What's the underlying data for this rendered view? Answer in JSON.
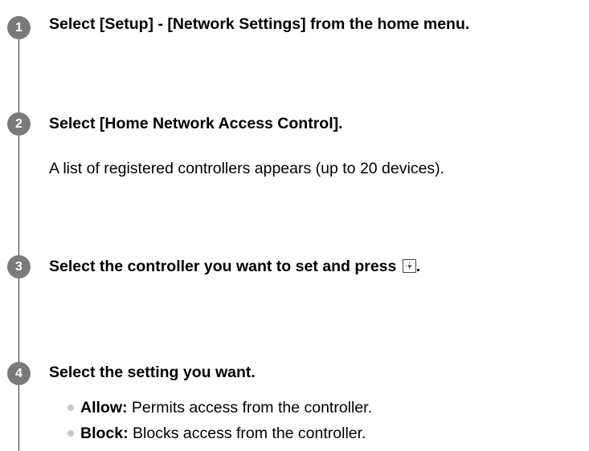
{
  "steps": [
    {
      "number": "1",
      "title": "Select [Setup] - [Network Settings] from the home menu."
    },
    {
      "number": "2",
      "title": "Select [Home Network Access Control].",
      "description": "A list of registered controllers appears (up to 20 devices)."
    },
    {
      "number": "3",
      "title": "Select the controller you want to set and press",
      "title_suffix": ".",
      "icon": "enter-button-icon"
    },
    {
      "number": "4",
      "title": "Select the setting you want.",
      "options": [
        {
          "label": "Allow:",
          "text": " Permits access from the controller."
        },
        {
          "label": "Block:",
          "text": " Blocks access from the controller."
        }
      ]
    }
  ]
}
